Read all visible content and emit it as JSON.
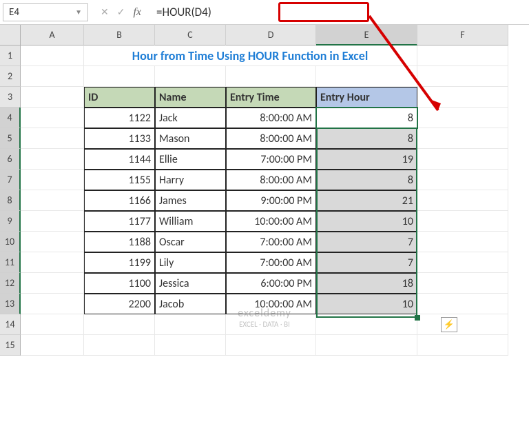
{
  "nameBox": "E4",
  "formula": "=HOUR(D4)",
  "columns": [
    "A",
    "B",
    "C",
    "D",
    "E",
    "F"
  ],
  "rows": [
    "1",
    "2",
    "3",
    "4",
    "5",
    "6",
    "7",
    "8",
    "9",
    "10",
    "11",
    "12",
    "13",
    "14",
    "15"
  ],
  "title": "Hour from Time Using HOUR Function in Excel",
  "headers": {
    "id": "ID",
    "name": "Name",
    "entry": "Entry Time",
    "hour": "Entry Hour"
  },
  "data": [
    {
      "id": "1122",
      "name": "Jack",
      "time": "8:00:00 AM",
      "hour": "8"
    },
    {
      "id": "1133",
      "name": "Mason",
      "time": "8:00:00 AM",
      "hour": "8"
    },
    {
      "id": "1144",
      "name": "Ellie",
      "time": "7:00:00 PM",
      "hour": "19"
    },
    {
      "id": "1155",
      "name": "Harry",
      "time": "8:00:00 AM",
      "hour": "8"
    },
    {
      "id": "1166",
      "name": "James",
      "time": "9:00:00 PM",
      "hour": "21"
    },
    {
      "id": "1177",
      "name": "William",
      "time": "10:00:00 AM",
      "hour": "10"
    },
    {
      "id": "1188",
      "name": "Oscar",
      "time": "7:00:00 AM",
      "hour": "7"
    },
    {
      "id": "1199",
      "name": "Lily",
      "time": "7:00:00 AM",
      "hour": "7"
    },
    {
      "id": "1100",
      "name": "Jessica",
      "time": "6:00:00 PM",
      "hour": "18"
    },
    {
      "id": "2200",
      "name": "Jacob",
      "time": "10:00:00 AM",
      "hour": "10"
    }
  ],
  "watermark": {
    "brand": "exceldemy",
    "tagline": "EXCEL · DATA · BI"
  },
  "autofillGlyph": "⚡",
  "chart_data": {
    "type": "table",
    "title": "Hour from Time Using HOUR Function in Excel",
    "columns": [
      "ID",
      "Name",
      "Entry Time",
      "Entry Hour"
    ],
    "rows": [
      [
        1122,
        "Jack",
        "8:00:00 AM",
        8
      ],
      [
        1133,
        "Mason",
        "8:00:00 AM",
        8
      ],
      [
        1144,
        "Ellie",
        "7:00:00 PM",
        19
      ],
      [
        1155,
        "Harry",
        "8:00:00 AM",
        8
      ],
      [
        1166,
        "James",
        "9:00:00 PM",
        21
      ],
      [
        1177,
        "William",
        "10:00:00 AM",
        10
      ],
      [
        1188,
        "Oscar",
        "7:00:00 AM",
        7
      ],
      [
        1199,
        "Lily",
        "7:00:00 AM",
        7
      ],
      [
        1100,
        "Jessica",
        "6:00:00 PM",
        18
      ],
      [
        2200,
        "Jacob",
        "10:00:00 AM",
        10
      ]
    ],
    "formula": "=HOUR(D4)"
  }
}
